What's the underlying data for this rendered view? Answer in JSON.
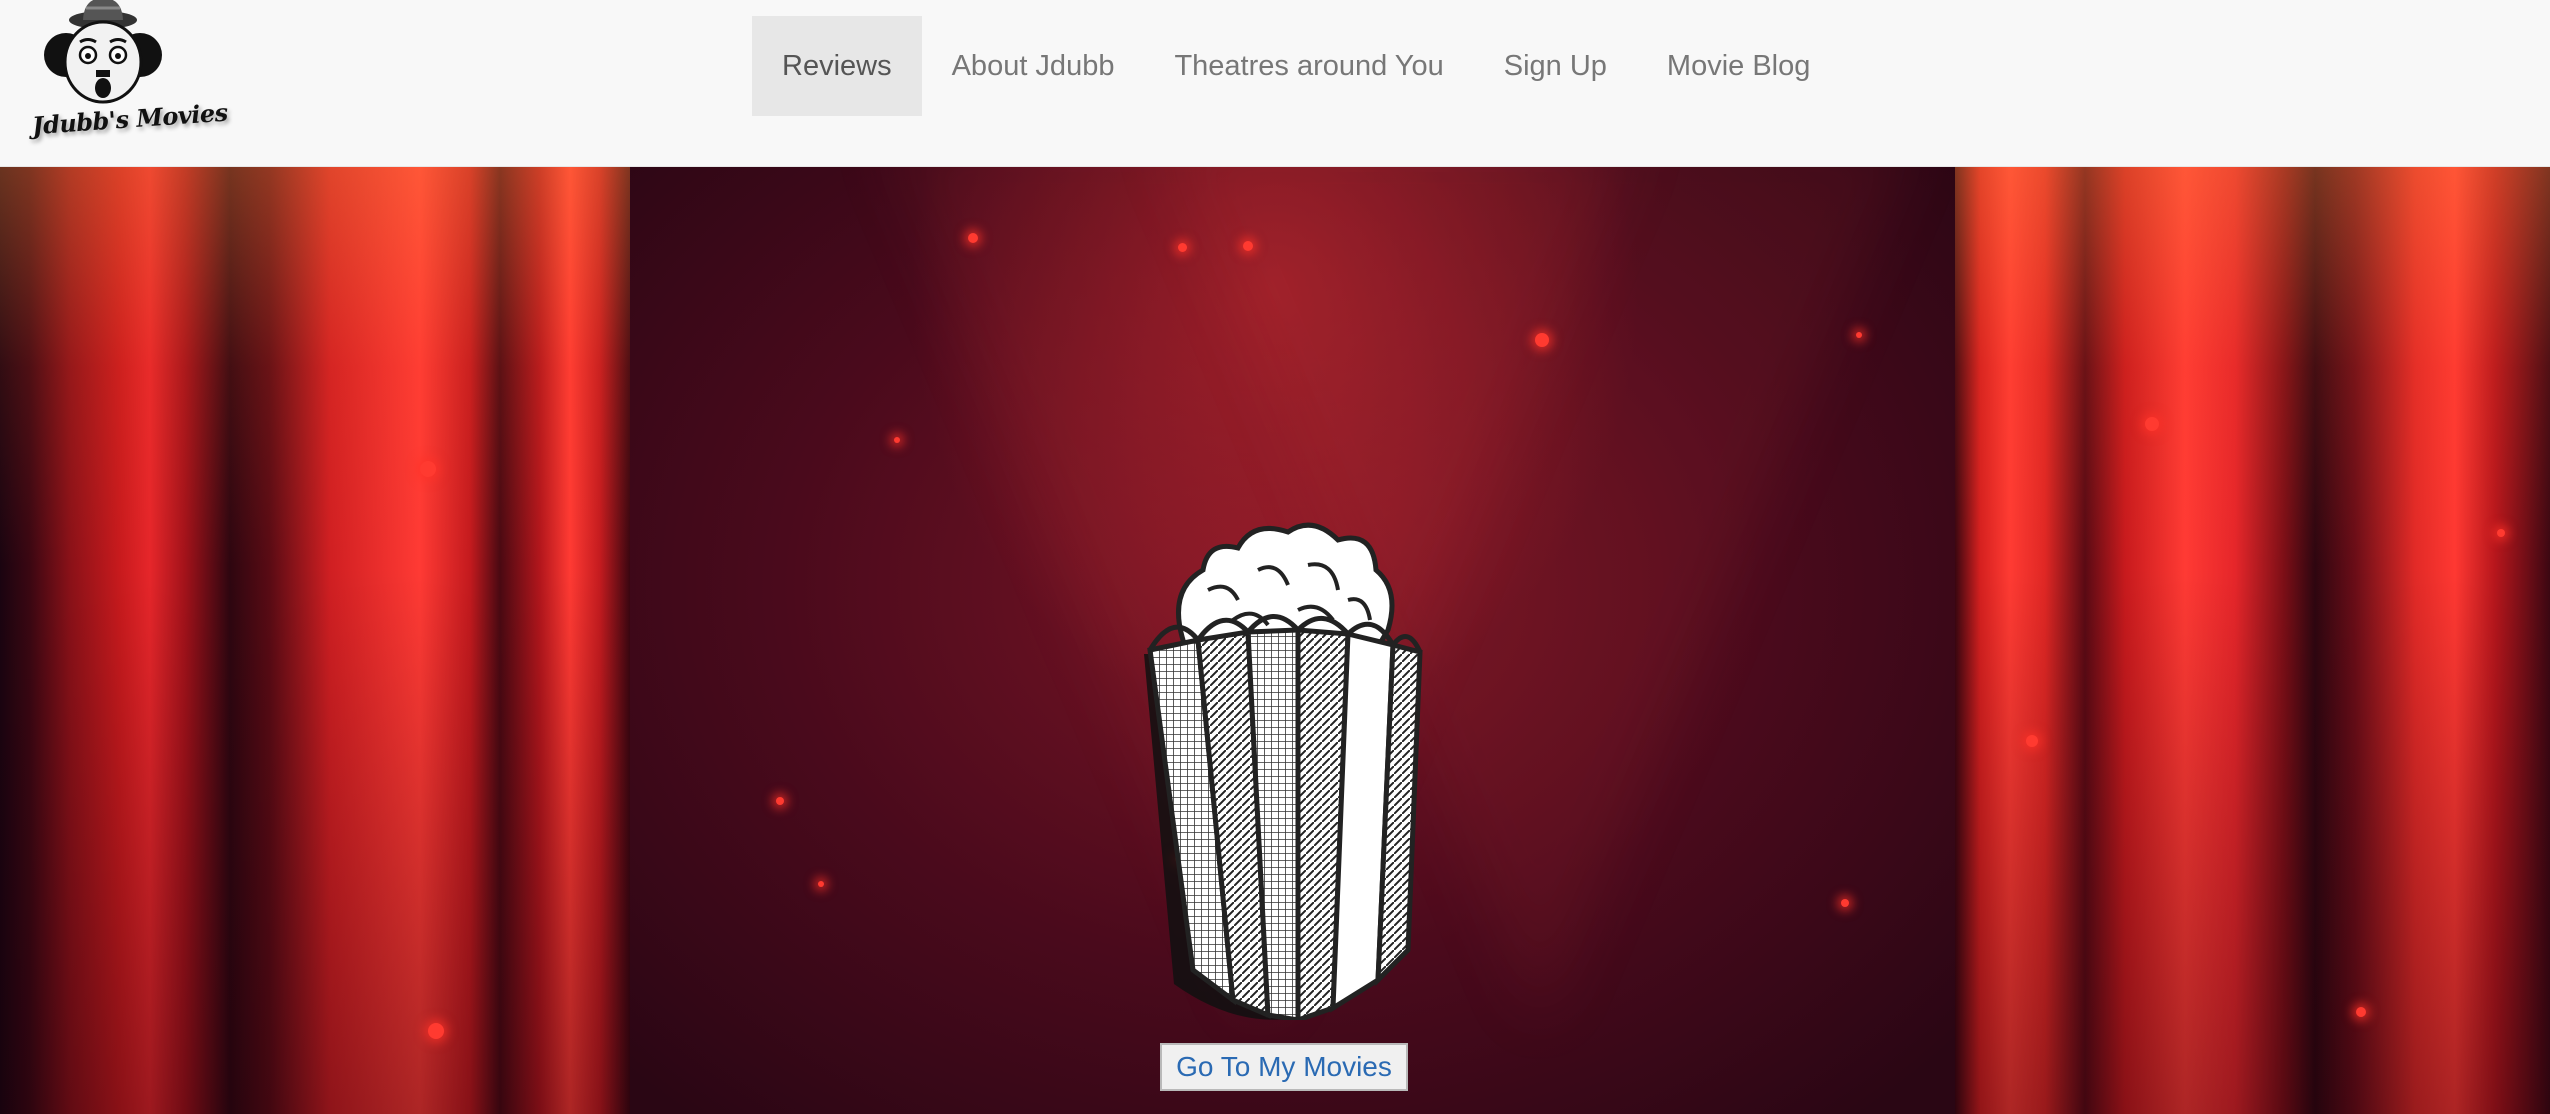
{
  "brand": {
    "logo_text": "Jdubb's Movies",
    "logo_icon": "chaplin-face-logo"
  },
  "nav": {
    "items": [
      {
        "label": "Reviews",
        "active": true
      },
      {
        "label": "About Jdubb",
        "active": false
      },
      {
        "label": "Theatres around You",
        "active": false
      },
      {
        "label": "Sign Up",
        "active": false
      },
      {
        "label": "Movie Blog",
        "active": false
      }
    ]
  },
  "hero": {
    "image": "popcorn-icon",
    "button_label": "Go To My Movies"
  },
  "colors": {
    "navbar_bg": "#f8f8f8",
    "active_tab_bg": "#e7e7e7",
    "nav_text": "#777777",
    "link_blue": "#2a6ab3",
    "curtain_red": "#e6262a",
    "stage_dark": "#4a0a1c"
  }
}
